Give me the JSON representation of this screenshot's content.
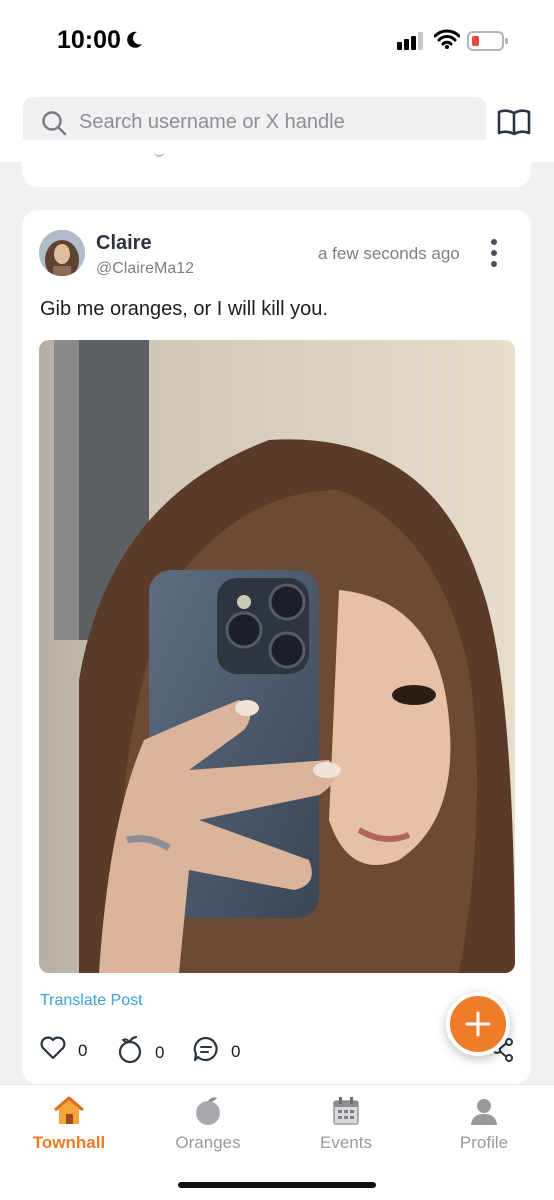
{
  "status_bar": {
    "time": "10:00",
    "icons": [
      "moon-icon",
      "signal-icon",
      "wifi-icon",
      "battery-icon"
    ],
    "battery_color": "#e5483d"
  },
  "search": {
    "placeholder": "Search username or X handle",
    "icons": [
      "search-icon",
      "book-icon"
    ]
  },
  "post": {
    "author_name": "Claire",
    "author_handle": "@ClaireMa12",
    "timestamp": "a few seconds ago",
    "text": "Gib me oranges, or I will kill you.",
    "photo": "selfie-photo",
    "translate_label": "Translate Post",
    "likes": "0",
    "oranges": "0",
    "comments": "0",
    "icons": [
      "more-icon",
      "heart-icon",
      "orange-icon",
      "comment-icon",
      "share-icon"
    ]
  },
  "fab": {
    "icon": "plus-icon",
    "color": "#f07c2a"
  },
  "tab_bar": {
    "active_color": "#ee7b27",
    "inactive_color": "#9a9a9e",
    "tabs": [
      {
        "label": "Townhall",
        "icon": "home-icon",
        "active": true
      },
      {
        "label": "Oranges",
        "icon": "orange-icon",
        "active": false
      },
      {
        "label": "Events",
        "icon": "calendar-icon",
        "active": false
      },
      {
        "label": "Profile",
        "icon": "profile-icon",
        "active": false
      }
    ]
  }
}
